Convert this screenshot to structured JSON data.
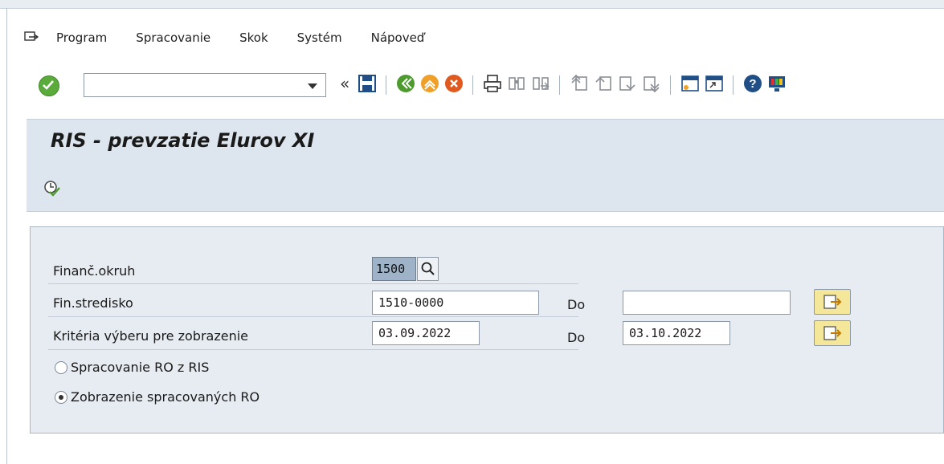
{
  "menu": {
    "items": [
      {
        "label": "Program"
      },
      {
        "label": "Spracovanie"
      },
      {
        "label": "Skok"
      },
      {
        "label": "Systém"
      },
      {
        "label": "Nápoveď"
      }
    ]
  },
  "toolbar": {
    "command_value": "",
    "icons": [
      "enter-icon",
      "save-icon",
      "back-icon",
      "exit-icon",
      "cancel-icon",
      "print-icon",
      "find-icon",
      "find-next-icon",
      "first-page-icon",
      "previous-page-icon",
      "next-page-icon",
      "last-page-icon",
      "new-session-icon",
      "shortcut-icon",
      "help-icon",
      "customize-layout-icon"
    ]
  },
  "screen": {
    "title": "RIS - prevzatie Elurov XI"
  },
  "form": {
    "fin_okruh": {
      "label": "Finanč.okruh",
      "value": "1500"
    },
    "fin_stredisko": {
      "label": "Fin.stredisko",
      "from": "1510-0000",
      "to_label": "Do",
      "to": ""
    },
    "kriteria": {
      "label": "Kritéria výberu pre zobrazenie",
      "from": "03.09.2022",
      "to_label": "Do",
      "to": "03.10.2022"
    },
    "radio1": {
      "label": "Spracovanie RO z RIS",
      "selected": false
    },
    "radio2": {
      "label": "Zobrazenie spracovaných RO",
      "selected": true
    }
  },
  "colors": {
    "title_bar": "#dde6ee",
    "panel": "#e6ecf2",
    "selected_field": "#9fb3c8",
    "multi_select_button": "#f5e79a"
  }
}
